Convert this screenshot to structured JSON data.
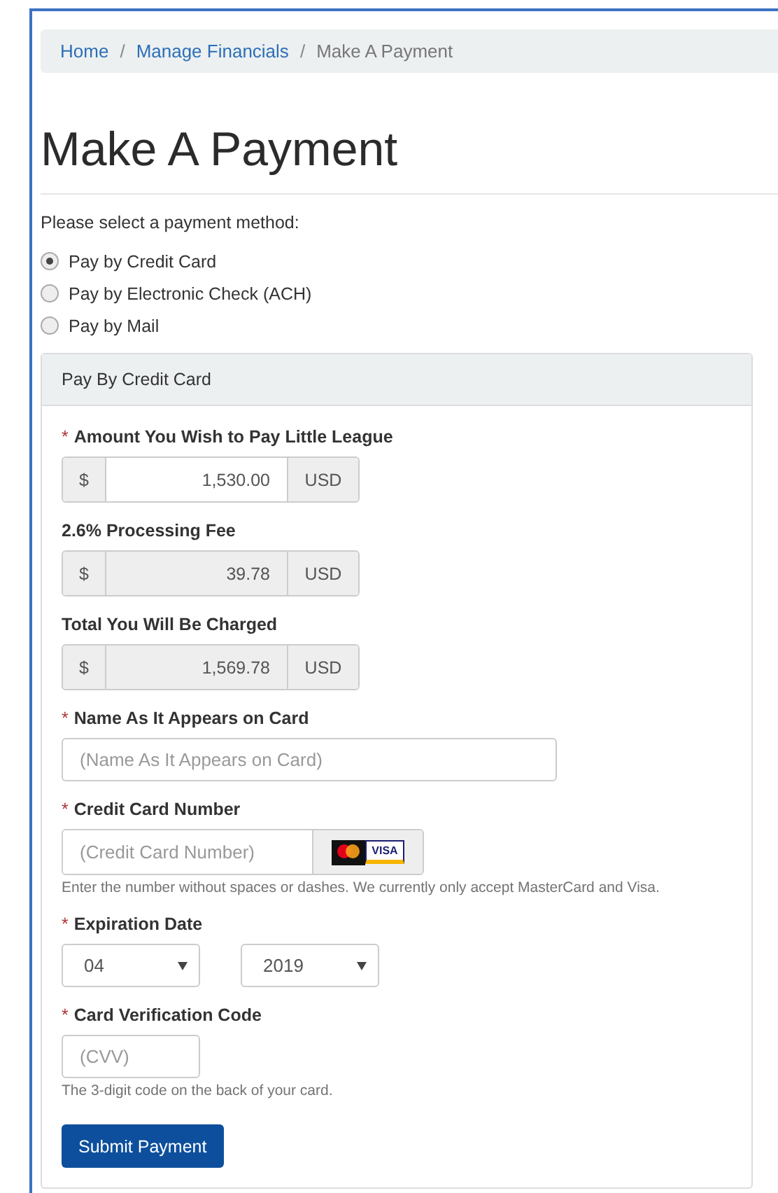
{
  "breadcrumb": {
    "separator": "/",
    "items": [
      {
        "label": "Home",
        "current": false
      },
      {
        "label": "Manage Financials",
        "current": false
      },
      {
        "label": "Make A Payment",
        "current": true
      }
    ]
  },
  "title": "Make A Payment",
  "method_prompt": "Please select a payment method:",
  "methods": [
    {
      "label": "Pay by Credit Card",
      "selected": true
    },
    {
      "label": "Pay by Electronic Check (ACH)",
      "selected": false
    },
    {
      "label": "Pay by Mail",
      "selected": false
    }
  ],
  "panel": {
    "heading": "Pay By Credit Card",
    "required_mark": "*",
    "fields": [
      {
        "kind": "currency",
        "label": "Amount You Wish to Pay Little League",
        "required": true,
        "prefix": "$",
        "value": "1,530.00",
        "suffix": "USD",
        "disabled": false
      },
      {
        "kind": "currency",
        "label": "2.6% Processing Fee",
        "required": false,
        "prefix": "$",
        "value": "39.78",
        "suffix": "USD",
        "disabled": true
      },
      {
        "kind": "currency",
        "label": "Total You Will Be Charged",
        "required": false,
        "prefix": "$",
        "value": "1,569.78",
        "suffix": "USD",
        "disabled": true
      },
      {
        "kind": "text",
        "label": "Name As It Appears on Card",
        "required": true,
        "placeholder": "(Name As It Appears on Card)"
      },
      {
        "kind": "card",
        "label": "Credit Card Number",
        "required": true,
        "placeholder": "(Credit Card Number)",
        "card_text": "VISA",
        "help": "Enter the number without spaces or dashes. We currently only accept MasterCard and Visa."
      },
      {
        "kind": "selects",
        "label": "Expiration Date",
        "required": true,
        "values": [
          "04",
          "2019"
        ]
      },
      {
        "kind": "short",
        "label": "Card Verification Code",
        "required": true,
        "placeholder": "(CVV)",
        "help": "The 3-digit code on the back of your card."
      }
    ],
    "submit": "Submit Payment"
  }
}
